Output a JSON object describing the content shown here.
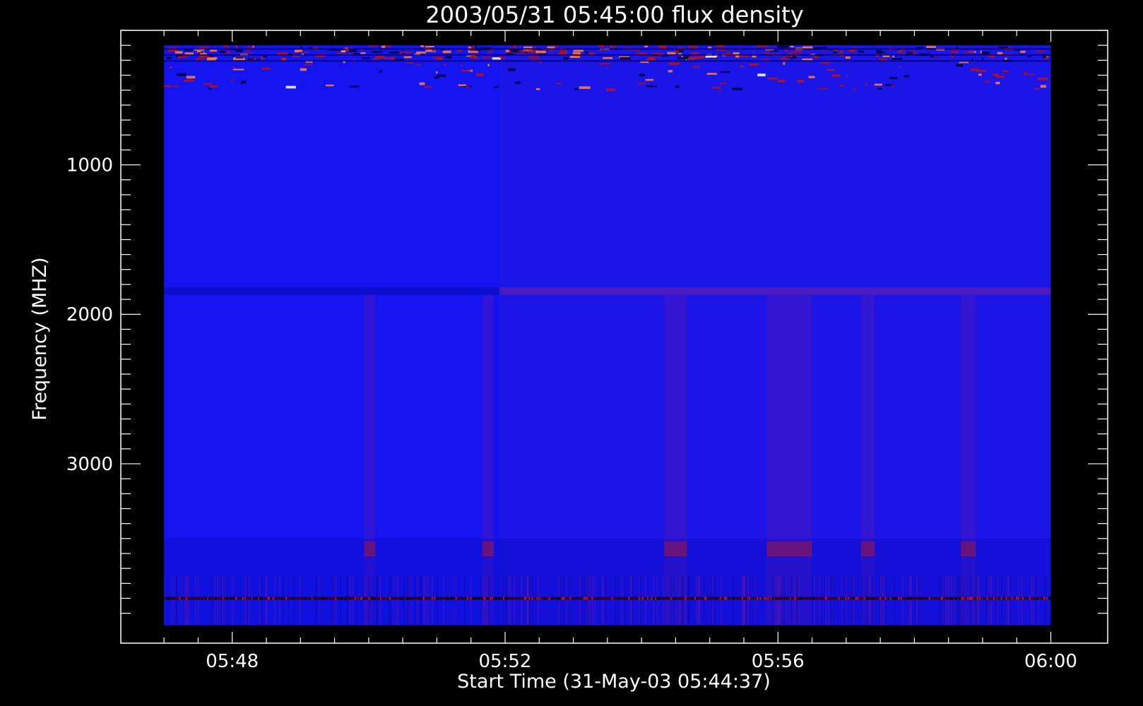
{
  "chart_data": {
    "type": "heatmap",
    "title": "2003/05/31 05:45:00 flux density",
    "xlabel": "Start Time (31-May-03 05:44:37)",
    "ylabel": "Frequency (MHZ)",
    "x_tick_labels": [
      "05:48",
      "05:52",
      "05:56",
      "06:00"
    ],
    "x_ticks_min": [
      180,
      420,
      660,
      900
    ],
    "x_minor_ticks_min": [
      120,
      150,
      180,
      210,
      240,
      270,
      300,
      330,
      360,
      390,
      420,
      450,
      480,
      510,
      540,
      570,
      600,
      630,
      660,
      690,
      720,
      750,
      780,
      810,
      840,
      870,
      900
    ],
    "xlim_min": [
      82,
      950
    ],
    "xlim_data_min": [
      120,
      900
    ],
    "y_tick_labels": [
      "1000",
      "2000",
      "3000"
    ],
    "y_ticks": [
      1000,
      2000,
      3000
    ],
    "y_minor_ticks": [
      100,
      200,
      300,
      400,
      500,
      600,
      700,
      800,
      900,
      1000,
      1100,
      1200,
      1300,
      1400,
      1500,
      1600,
      1700,
      1800,
      1900,
      2000,
      2100,
      2200,
      2300,
      2400,
      2500,
      2600,
      2700,
      2800,
      2900,
      3000,
      3100,
      3200,
      3300,
      3400,
      3500,
      3600,
      3700,
      3800,
      3900,
      4000
    ],
    "ylim": [
      100,
      4200
    ],
    "ylim_data": [
      200,
      4080
    ],
    "y_inverted": true,
    "colormap": [
      "#1010f0",
      "#3a10c0",
      "#801060",
      "#c01010",
      "#ff8040",
      "#ffffff"
    ],
    "background": "#1414f0",
    "bright_time_bands_min": [
      [
        296,
        306
      ],
      [
        400,
        410
      ],
      [
        560,
        580
      ],
      [
        650,
        672
      ],
      [
        672,
        690
      ],
      [
        733,
        745
      ],
      [
        821,
        834
      ]
    ],
    "bright_band_after_min": 415,
    "feature_freq_band_mhz": [
      1820,
      1870
    ],
    "noisy_low_freq_band_mhz": [
      200,
      500
    ],
    "noisy_high_freq_band_mhz": [
      3500,
      4080
    ],
    "rfi_line_mhz": 3900
  }
}
